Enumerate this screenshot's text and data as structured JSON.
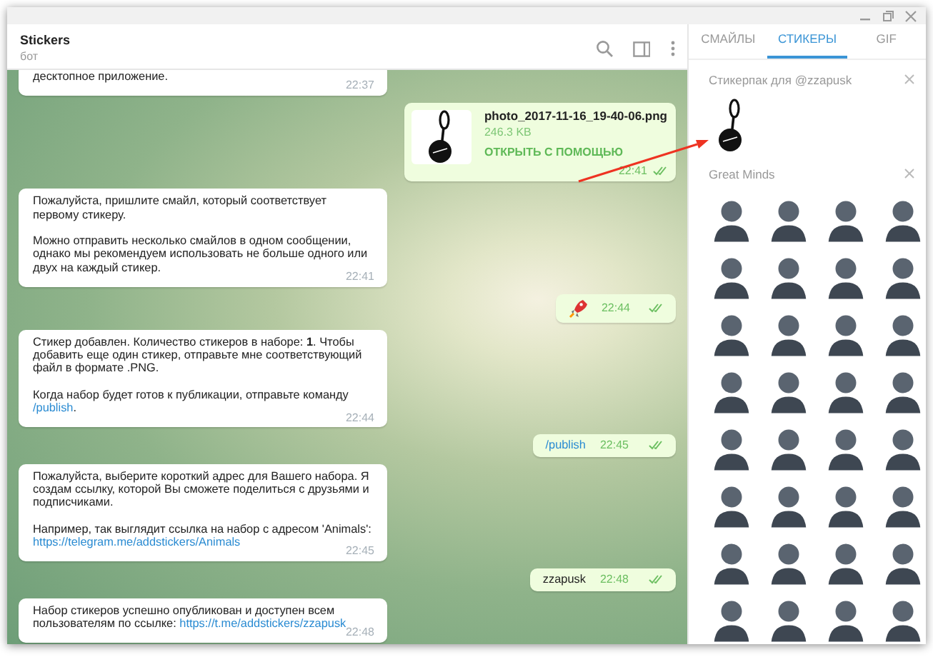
{
  "window": {
    "title": "Stickers",
    "subtitle": "бот"
  },
  "messages": [
    {
      "kind": "text",
      "outgoing": false,
      "paragraphs": [
        [
          {
            "text": "десктопное приложение."
          }
        ]
      ],
      "time": "22:37"
    },
    {
      "kind": "file",
      "outgoing": true,
      "file_name": "photo_2017-11-16_19-40-06.png",
      "file_size": "246.3 KB",
      "action": "ОТКРЫТЬ С ПОМОЩЬЮ",
      "time": "22:41",
      "read": true
    },
    {
      "kind": "text",
      "outgoing": false,
      "paragraphs": [
        [
          {
            "text": "Пожалуйста, пришлите смайл, который соответствует первому стикеру."
          }
        ],
        [
          {
            "text": "Можно отправить несколько смайлов в одном сообщении, однако мы рекомендуем использовать не больше одного или двух на каждый стикер."
          }
        ]
      ],
      "time": "22:41"
    },
    {
      "kind": "emoji",
      "outgoing": true,
      "time": "22:44",
      "read": true
    },
    {
      "kind": "text",
      "outgoing": false,
      "paragraphs": [
        [
          {
            "text": "Стикер добавлен. Количество стикеров в наборе: **1**. Чтобы добавить еще один стикер, отправьте мне соответствующий файл в формате .PNG."
          }
        ],
        [
          {
            "text": "Когда набор будет готов к публикации, отправьте команду "
          },
          {
            "link": "/publish"
          },
          {
            "text": "."
          }
        ]
      ],
      "time": "22:44"
    },
    {
      "kind": "command",
      "outgoing": true,
      "text": "/publish",
      "time": "22:45",
      "read": true
    },
    {
      "kind": "text",
      "outgoing": false,
      "paragraphs": [
        [
          {
            "text": "Пожалуйста, выберите короткий адрес для Вашего набора. Я создам ссылку, которой Вы сможете поделиться с друзьями и подписчиками."
          }
        ],
        [
          {
            "text": "Например, так выглядит ссылка на набор с адресом 'Animals': "
          },
          {
            "link": "https://telegram.me/addstickers/Animals"
          }
        ]
      ],
      "time": "22:45"
    },
    {
      "kind": "plain",
      "outgoing": true,
      "text": "zzapusk",
      "time": "22:48",
      "read": true
    },
    {
      "kind": "text",
      "outgoing": false,
      "paragraphs": [
        [
          {
            "text": "Набор стикеров успешно опубликован и доступен всем пользователям по ссылке: "
          },
          {
            "link": "https://t.me/addstickers/zzapusk"
          }
        ]
      ],
      "time": "22:48"
    }
  ],
  "panel": {
    "tabs": [
      {
        "label": "СМАЙЛЫ",
        "selected": false
      },
      {
        "label": "СТИКЕРЫ",
        "selected": true
      },
      {
        "label": "GIF",
        "selected": false
      }
    ],
    "sections": [
      {
        "title": "Стикерпак для @zzapusk",
        "kind": "own"
      },
      {
        "title": "Great Minds",
        "kind": "portraits"
      }
    ]
  }
}
